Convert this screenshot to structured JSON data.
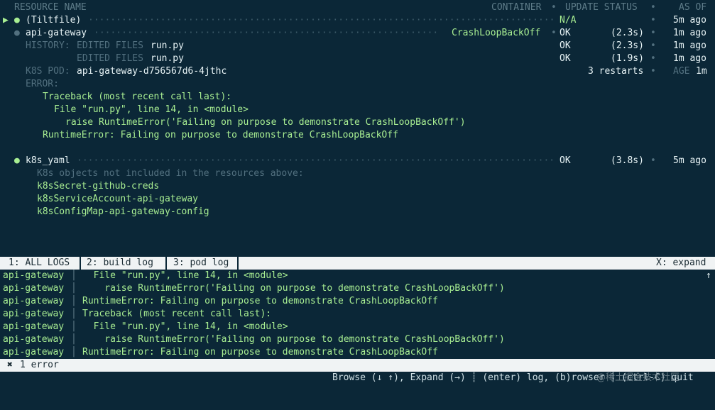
{
  "header": {
    "resource_name": "RESOURCE NAME",
    "container": "CONTAINER",
    "update_status": "UPDATE STATUS",
    "as_of": "AS OF"
  },
  "resources": {
    "tiltfile": {
      "marker": "▶",
      "name": "(Tiltfile)",
      "status": "N/A",
      "as_of": "5m ago"
    },
    "api_gateway": {
      "name": "api-gateway",
      "container": "CrashLoopBackOff",
      "status": "OK",
      "duration": "(2.3s)",
      "as_of": "1m ago",
      "history_label": "HISTORY:",
      "history": [
        {
          "label": "EDITED FILES",
          "file": "run.py",
          "status": "OK",
          "duration": "(2.3s)",
          "as_of": "1m ago"
        },
        {
          "label": "EDITED FILES",
          "file": "run.py",
          "status": "OK",
          "duration": "(1.9s)",
          "as_of": "1m ago"
        }
      ],
      "pod_label": "K8S POD:",
      "pod_name": "api-gateway-d756567d6-4jthc",
      "restarts": "3 restarts",
      "age_label": "AGE",
      "age": "1m",
      "error_label": "ERROR:",
      "error_lines": [
        "Traceback (most recent call last):",
        "File \"run.py\", line 14, in <module>",
        "raise RuntimeError('Failing on purpose to demonstrate CrashLoopBackOff')",
        "RuntimeError: Failing on purpose to demonstrate CrashLoopBackOff"
      ]
    },
    "k8s_yaml": {
      "name": "k8s_yaml",
      "status": "OK",
      "duration": "(3.8s)",
      "as_of": "5m ago",
      "note": "K8s objects not included in the resources above:",
      "objects": [
        "k8sSecret-github-creds",
        "k8sServiceAccount-api-gateway",
        "k8sConfigMap-api-gateway-config"
      ]
    }
  },
  "tabs": {
    "all_logs": "1: ALL LOGS",
    "build_log": "2: build log",
    "pod_log": "3: pod log",
    "expand": "X: expand"
  },
  "logs": [
    {
      "source": "api-gateway",
      "text": "  File \"run.py\", line 14, in <module>"
    },
    {
      "source": "api-gateway",
      "text": "    raise RuntimeError('Failing on purpose to demonstrate CrashLoopBackOff')"
    },
    {
      "source": "api-gateway",
      "text": "RuntimeError: Failing on purpose to demonstrate CrashLoopBackOff"
    },
    {
      "source": "api-gateway",
      "text": "Traceback (most recent call last):"
    },
    {
      "source": "api-gateway",
      "text": "  File \"run.py\", line 14, in <module>"
    },
    {
      "source": "api-gateway",
      "text": "    raise RuntimeError('Failing on purpose to demonstrate CrashLoopBackOff')"
    },
    {
      "source": "api-gateway",
      "text": "RuntimeError: Failing on purpose to demonstrate CrashLoopBackOff"
    }
  ],
  "scroll_arrow": "↑",
  "error_bar": {
    "icon": "✖",
    "text": "1 error"
  },
  "footer": "Browse (↓ ↑), Expand (→) ┊ (enter) log, (b)rowser ┊ (ctrl-C) quit",
  "watermark": "@稀土掘金技术社区",
  "bullet": "●",
  "bullet_small": "•",
  "bar": "│"
}
